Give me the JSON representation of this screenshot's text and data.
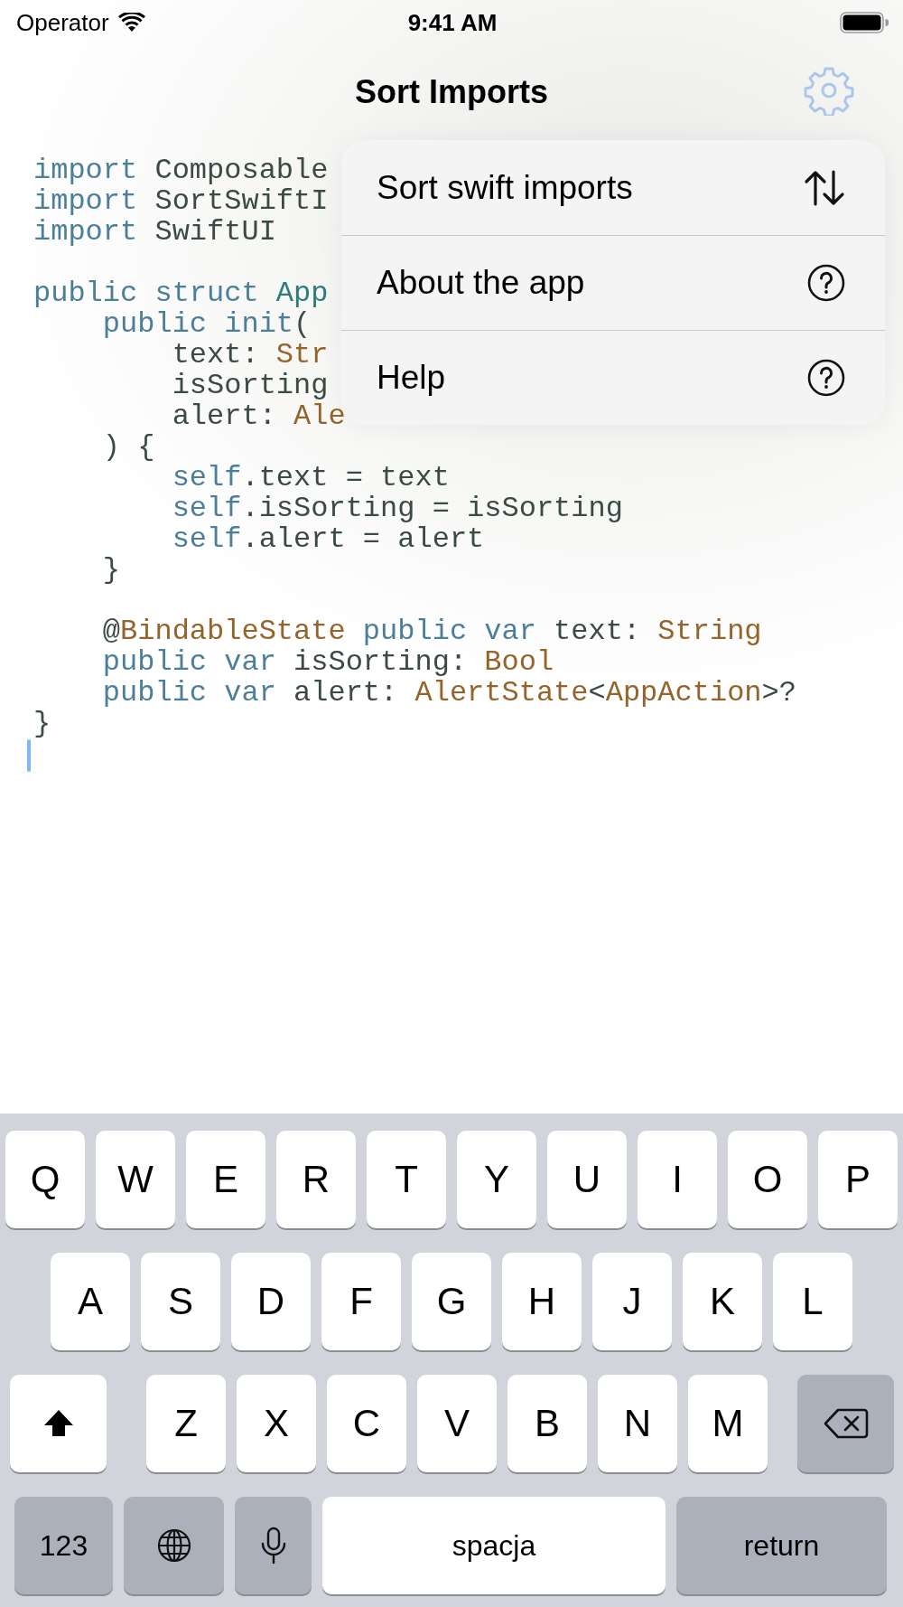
{
  "status_bar": {
    "carrier": "Operator",
    "time": "9:41 AM"
  },
  "nav": {
    "title": "Sort Imports"
  },
  "code": {
    "blocks": [
      {
        "lines": [
          {
            "tokens": [
              {
                "kind": "keyword",
                "text": "import"
              },
              {
                "kind": "plain",
                "text": " Composable"
              }
            ]
          },
          {
            "tokens": [
              {
                "kind": "keyword",
                "text": "import"
              },
              {
                "kind": "plain",
                "text": " SortSwiftI"
              }
            ]
          },
          {
            "tokens": [
              {
                "kind": "keyword",
                "text": "import"
              },
              {
                "kind": "plain",
                "text": " SwiftUI"
              }
            ]
          }
        ]
      },
      {
        "lines": [
          {
            "tokens": [
              {
                "kind": "keyword",
                "text": "public struct"
              },
              {
                "kind": "declaration",
                "text": " App"
              }
            ]
          },
          {
            "tokens": [
              {
                "kind": "keyword",
                "text": "    public init"
              },
              {
                "kind": "plain",
                "text": "("
              }
            ]
          },
          {
            "tokens": [
              {
                "kind": "plain",
                "text": "        text: "
              },
              {
                "kind": "type",
                "text": "Str"
              }
            ]
          },
          {
            "tokens": [
              {
                "kind": "plain",
                "text": "        isSorting"
              }
            ]
          },
          {
            "tokens": [
              {
                "kind": "plain",
                "text": "        alert: "
              },
              {
                "kind": "type",
                "text": "Ale"
              }
            ]
          },
          {
            "tokens": [
              {
                "kind": "plain",
                "text": "    ) {"
              }
            ]
          },
          {
            "tokens": [
              {
                "kind": "keyword",
                "text": "        self"
              },
              {
                "kind": "plain",
                "text": ".text = text"
              }
            ]
          },
          {
            "tokens": [
              {
                "kind": "keyword",
                "text": "        self"
              },
              {
                "kind": "plain",
                "text": ".isSorting = isSorting"
              }
            ]
          },
          {
            "tokens": [
              {
                "kind": "keyword",
                "text": "        self"
              },
              {
                "kind": "plain",
                "text": ".alert = alert"
              }
            ]
          },
          {
            "tokens": [
              {
                "kind": "plain",
                "text": "    }"
              }
            ]
          }
        ]
      },
      {
        "lines": [
          {
            "tokens": [
              {
                "kind": "plain",
                "text": "    @"
              },
              {
                "kind": "type",
                "text": "BindableState"
              },
              {
                "kind": "keyword",
                "text": " public var"
              },
              {
                "kind": "plain",
                "text": " text: "
              },
              {
                "kind": "type",
                "text": "String"
              }
            ]
          },
          {
            "tokens": [
              {
                "kind": "keyword",
                "text": "    public var"
              },
              {
                "kind": "plain",
                "text": " isSorting: "
              },
              {
                "kind": "type",
                "text": "Bool"
              }
            ]
          },
          {
            "tokens": [
              {
                "kind": "keyword",
                "text": "    public var"
              },
              {
                "kind": "plain",
                "text": " alert: "
              },
              {
                "kind": "type",
                "text": "AlertState"
              },
              {
                "kind": "plain",
                "text": "<"
              },
              {
                "kind": "type",
                "text": "AppAction"
              },
              {
                "kind": "plain",
                "text": ">?"
              }
            ]
          },
          {
            "tokens": [
              {
                "kind": "plain",
                "text": "}"
              }
            ]
          }
        ]
      }
    ]
  },
  "menu": {
    "items": [
      {
        "label": "Sort swift imports",
        "kind": "sort"
      },
      {
        "label": "About the app",
        "kind": "help"
      },
      {
        "label": "Help",
        "kind": "help"
      }
    ]
  },
  "keyboard": {
    "rows": [
      {
        "keys": [
          {
            "kind": "letter",
            "label": "Q"
          },
          {
            "kind": "letter",
            "label": "W"
          },
          {
            "kind": "letter",
            "label": "E"
          },
          {
            "kind": "letter",
            "label": "R"
          },
          {
            "kind": "letter",
            "label": "T"
          },
          {
            "kind": "letter",
            "label": "Y"
          },
          {
            "kind": "letter",
            "label": "U"
          },
          {
            "kind": "letter",
            "label": "I"
          },
          {
            "kind": "letter",
            "label": "O"
          },
          {
            "kind": "letter",
            "label": "P"
          }
        ]
      },
      {
        "keys": [
          {
            "kind": "letter",
            "label": "A"
          },
          {
            "kind": "letter",
            "label": "S"
          },
          {
            "kind": "letter",
            "label": "D"
          },
          {
            "kind": "letter",
            "label": "F"
          },
          {
            "kind": "letter",
            "label": "G"
          },
          {
            "kind": "letter",
            "label": "H"
          },
          {
            "kind": "letter",
            "label": "J"
          },
          {
            "kind": "letter",
            "label": "K"
          },
          {
            "kind": "letter",
            "label": "L"
          }
        ]
      },
      {
        "keys": [
          {
            "kind": "shift"
          },
          {
            "kind": "letter",
            "label": "Z"
          },
          {
            "kind": "letter",
            "label": "X"
          },
          {
            "kind": "letter",
            "label": "C"
          },
          {
            "kind": "letter",
            "label": "V"
          },
          {
            "kind": "letter",
            "label": "B"
          },
          {
            "kind": "letter",
            "label": "N"
          },
          {
            "kind": "letter",
            "label": "M"
          },
          {
            "kind": "delete"
          }
        ]
      },
      {
        "keys": [
          {
            "kind": "numbers",
            "label": "123"
          },
          {
            "kind": "globe"
          },
          {
            "kind": "mic"
          },
          {
            "kind": "space",
            "label": "spacja"
          },
          {
            "kind": "return",
            "label": "return"
          }
        ]
      }
    ]
  }
}
